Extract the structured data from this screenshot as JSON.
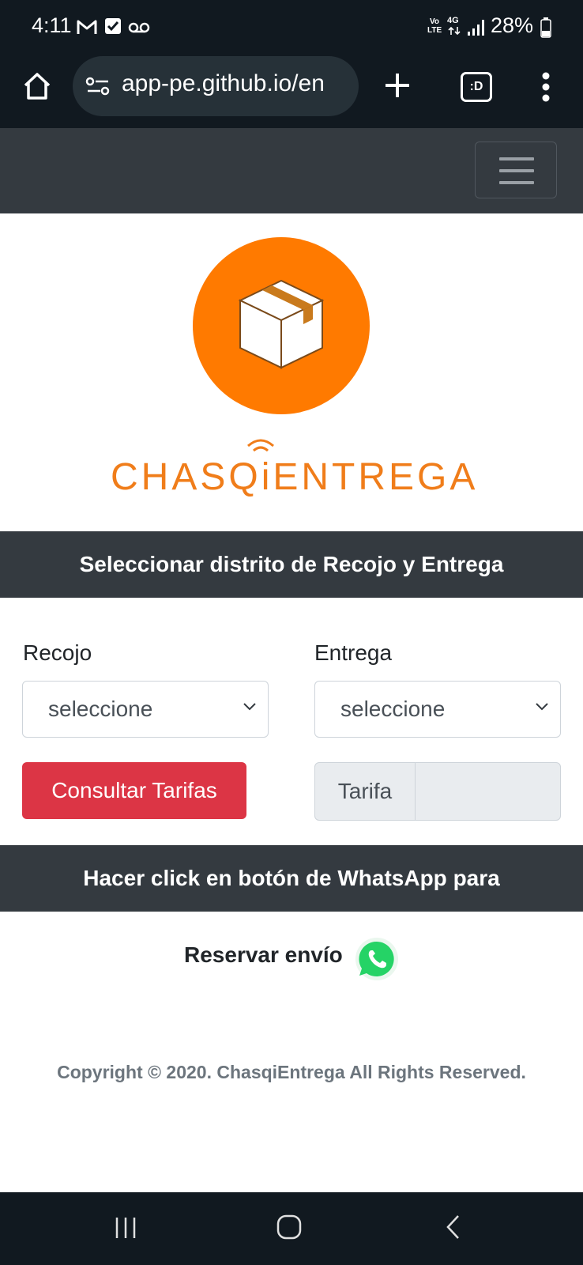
{
  "status_bar": {
    "time": "4:11",
    "battery": "28%",
    "icons": [
      "gmail-icon",
      "checkbox-notification-icon",
      "voicemail-icon",
      "volte-icon",
      "4g-icon",
      "signal-icon",
      "battery-icon"
    ],
    "network_label": "4G",
    "volte_label": "Vo LTE"
  },
  "browser": {
    "url": "app-pe.github.io/en",
    "tab_label": ":D",
    "icons": [
      "home-icon",
      "site-settings-icon",
      "new-tab-plus-icon",
      "tabs-icon",
      "more-menu-icon"
    ]
  },
  "brand": {
    "name": "CHASQiENTREGA",
    "colors": {
      "orange": "#ff7a00",
      "dark": "#343a40",
      "red": "#dc3545"
    }
  },
  "section1": {
    "title": "Seleccionar distrito de Recojo y Entrega"
  },
  "form": {
    "recojo_label": "Recojo",
    "recojo_value": "seleccione",
    "entrega_label": "Entrega",
    "entrega_value": "seleccione",
    "consultar_button": "Consultar Tarifas",
    "tarifa_label": "Tarifa",
    "tarifa_value": ""
  },
  "section2": {
    "title": "Hacer click en botón de WhatsApp para"
  },
  "reservar": {
    "label": "Reservar envío"
  },
  "footer": {
    "copyright": "Copyright © 2020. ChasqiEntrega All Rights Reserved."
  },
  "nav_buttons": [
    "recent-apps-icon",
    "home-button-icon",
    "back-icon"
  ]
}
